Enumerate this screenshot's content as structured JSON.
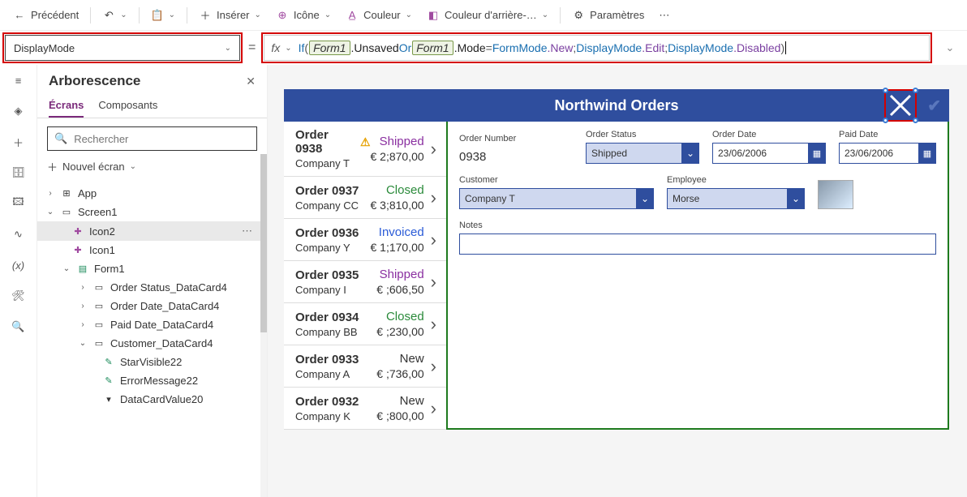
{
  "toolbar": {
    "back": "Précédent",
    "insert": "Insérer",
    "icon": "Icône",
    "color": "Couleur",
    "bgcolor": "Couleur d'arrière-…",
    "settings": "Paramètres"
  },
  "formula": {
    "property": "DisplayMode",
    "fx": "fx",
    "tokens": {
      "if": "If",
      "form1a": "Form1",
      "unsaved": ".Unsaved",
      "or": "Or",
      "form1b": "Form1",
      "mode": ".Mode",
      "eq": " = ",
      "formmode": "FormMode",
      "new": ".New",
      "sep1": "; ",
      "dm1": "DisplayMode",
      "edit": ".Edit",
      "sep2": "; ",
      "dm2": "DisplayMode",
      "disabled": ".Disabled"
    }
  },
  "tree": {
    "title": "Arborescence",
    "tab_screens": "Écrans",
    "tab_components": "Composants",
    "search_placeholder": "Rechercher",
    "new_screen": "Nouvel écran",
    "items": {
      "app": "App",
      "screen1": "Screen1",
      "icon2": "Icon2",
      "icon1": "Icon1",
      "form1": "Form1",
      "ds_orderstatus": "Order Status_DataCard4",
      "ds_orderdate": "Order Date_DataCard4",
      "ds_paiddate": "Paid Date_DataCard4",
      "ds_customer": "Customer_DataCard4",
      "starvisible": "StarVisible22",
      "errmsg": "ErrorMessage22",
      "dcvalue": "DataCardValue20"
    }
  },
  "app": {
    "title": "Northwind Orders",
    "orders": [
      {
        "num": "Order 0938",
        "warn": true,
        "company": "Company T",
        "status": "Shipped",
        "status_cls": "st-shipped",
        "price": "€ 2;870,00"
      },
      {
        "num": "Order 0937",
        "warn": false,
        "company": "Company CC",
        "status": "Closed",
        "status_cls": "st-closed",
        "price": "€ 3;810,00"
      },
      {
        "num": "Order 0936",
        "warn": false,
        "company": "Company Y",
        "status": "Invoiced",
        "status_cls": "st-invoiced",
        "price": "€ 1;170,00"
      },
      {
        "num": "Order 0935",
        "warn": false,
        "company": "Company I",
        "status": "Shipped",
        "status_cls": "st-shipped",
        "price": "€ ;606,50"
      },
      {
        "num": "Order 0934",
        "warn": false,
        "company": "Company BB",
        "status": "Closed",
        "status_cls": "st-closed",
        "price": "€ ;230,00"
      },
      {
        "num": "Order 0933",
        "warn": false,
        "company": "Company A",
        "status": "New",
        "status_cls": "st-new",
        "price": "€ ;736,00"
      },
      {
        "num": "Order 0932",
        "warn": false,
        "company": "Company K",
        "status": "New",
        "status_cls": "st-new",
        "price": "€ ;800,00"
      }
    ],
    "form": {
      "order_number_label": "Order Number",
      "order_number": "0938",
      "order_status_label": "Order Status",
      "order_status": "Shipped",
      "order_date_label": "Order Date",
      "order_date": "23/06/2006",
      "paid_date_label": "Paid Date",
      "paid_date": "23/06/2006",
      "customer_label": "Customer",
      "customer": "Company T",
      "employee_label": "Employee",
      "employee": "Morse",
      "notes_label": "Notes"
    }
  }
}
